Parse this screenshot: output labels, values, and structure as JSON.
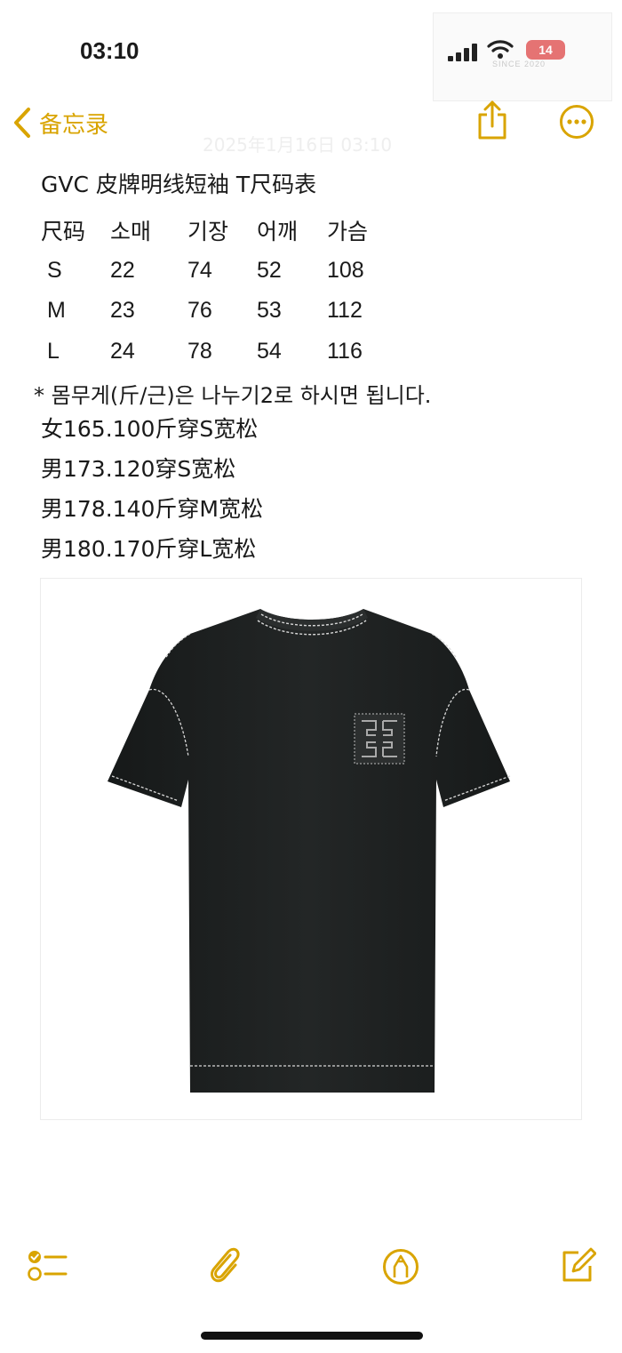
{
  "status_bar": {
    "time": "03:10",
    "battery": "14",
    "watermark": "SINCE 2020"
  },
  "nav": {
    "back_label": "备忘录",
    "icons": [
      "share-icon",
      "more-icon"
    ],
    "accent": "#D9A400"
  },
  "note": {
    "date_watermark": "2025年1月16日 03:10",
    "title": "GVC 皮牌明线短袖 T尺码表",
    "table": {
      "headers": [
        "尺码",
        "소매",
        "기장",
        "어깨",
        "가슴"
      ],
      "rows": [
        [
          "S",
          "22",
          "74",
          "52",
          "108"
        ],
        [
          "M",
          "23",
          "76",
          "53",
          "112"
        ],
        [
          "L",
          "24",
          "78",
          "54",
          "116"
        ]
      ]
    },
    "lines": [
      "* 몸무게(斤/근)은 나누기2로 하시면 됩니다.",
      "女165.100斤穿S宽松",
      "男173.120穿S宽松",
      "男178.140斤穿M宽松",
      "男180.170斤穿L宽松"
    ]
  },
  "image": {
    "subject": "black short-sleeve t-shirt with white contrast stitching and embroidered 4G patch",
    "shirt_color": "#1f2222",
    "stitch_color": "#d8d8d8"
  },
  "toolbar": {
    "icons": [
      "checklist-icon",
      "paperclip-icon",
      "markup-pen-icon",
      "compose-icon"
    ]
  }
}
